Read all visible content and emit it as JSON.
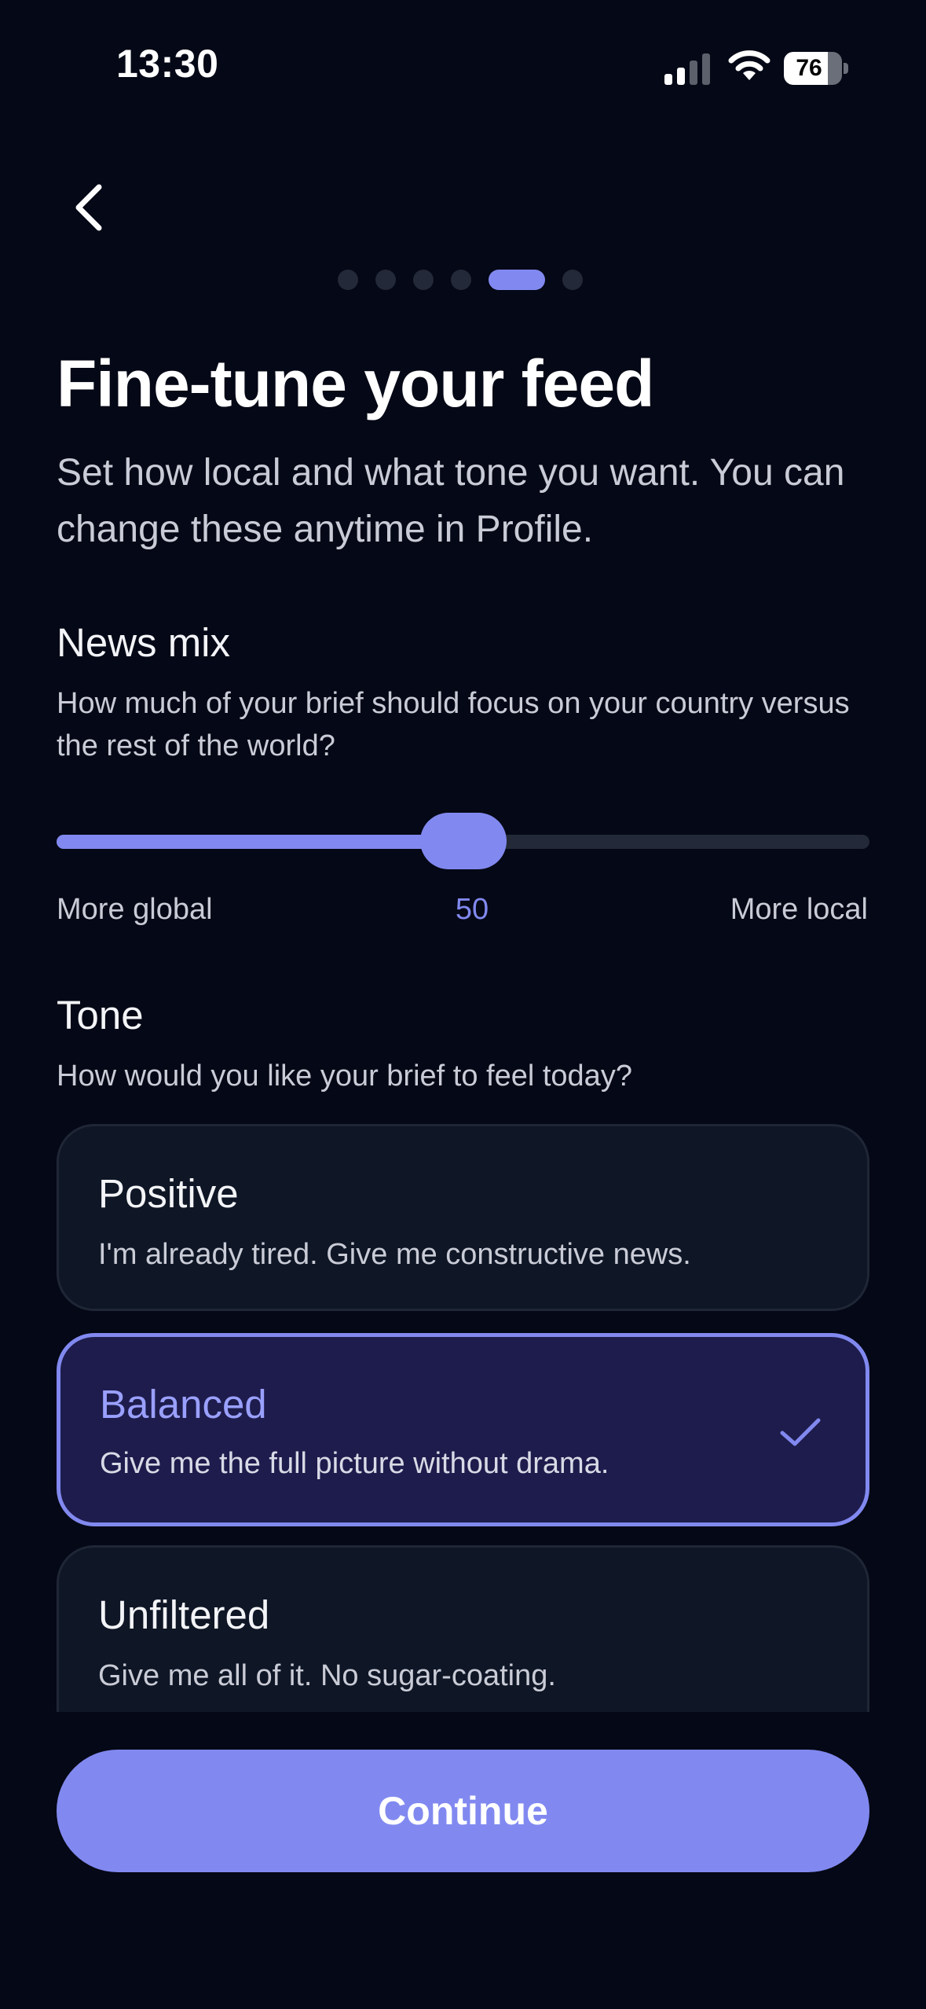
{
  "status_bar": {
    "time": "13:30",
    "battery_level": "76",
    "battery_fraction": 0.76,
    "signal_icon": "cellular-signal-icon",
    "wifi_icon": "wifi-icon"
  },
  "nav": {
    "back_icon": "chevron-left-icon",
    "steps_total": 6,
    "current_step": 5
  },
  "header": {
    "title": "Fine-tune your feed",
    "subtitle": "Set how local and what tone you want. You can change these anytime in Profile."
  },
  "news_mix": {
    "label": "News mix",
    "help": "How much of your brief should focus on your country versus the rest of the world?",
    "min_label": "More global",
    "max_label": "More local",
    "value": "50",
    "fraction": 0.5
  },
  "tone": {
    "label": "Tone",
    "help": "How would you like your brief to feel today?",
    "options": [
      {
        "title": "Positive",
        "description": "I'm already tired. Give me constructive news.",
        "selected": false
      },
      {
        "title": "Balanced",
        "description": "Give me the full picture without drama.",
        "selected": true
      },
      {
        "title": "Unfiltered",
        "description": "Give me all of it. No sugar-coating.",
        "selected": false
      }
    ],
    "check_icon": "checkmark-icon"
  },
  "footer": {
    "continue_label": "Continue"
  },
  "colors": {
    "background": "#050816",
    "accent": "#8189f0",
    "card": "#0f1626",
    "card_selected": "#1e1c4c"
  }
}
